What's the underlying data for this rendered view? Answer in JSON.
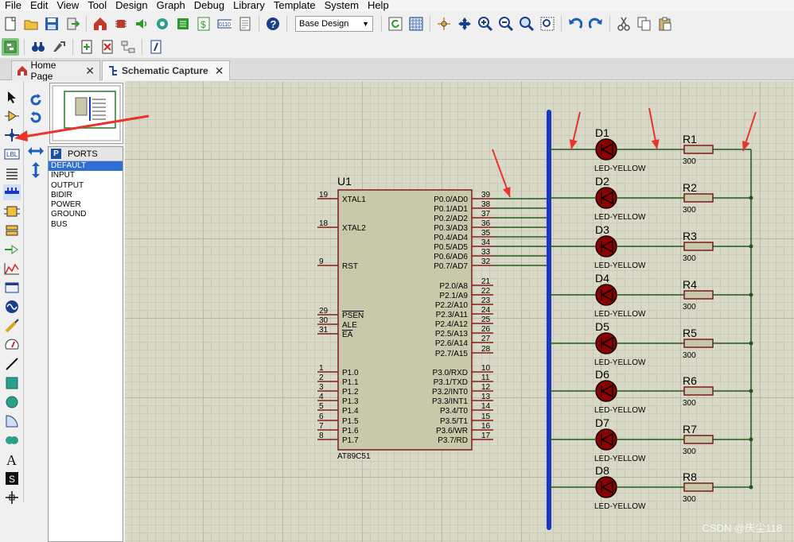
{
  "menu": [
    "File",
    "Edit",
    "View",
    "Tool",
    "Design",
    "Graph",
    "Debug",
    "Library",
    "Template",
    "System",
    "Help"
  ],
  "toolbar": {
    "design_select": "Base Design",
    "left_icons": [
      "new-file-icon",
      "open-folder-icon",
      "save-icon",
      "import-icon",
      "home-icon",
      "chip-icon",
      "audio-icon",
      "probe-icon",
      "bill-icon",
      "dollar-icon",
      "binary-icon",
      "document-icon",
      "help-icon"
    ],
    "right_icons": [
      "refresh-icon",
      "grid-icon",
      "origin-icon",
      "pan-icon",
      "zoom-in-icon",
      "zoom-out-icon",
      "zoom-all-icon",
      "zoom-area-icon",
      "undo-icon",
      "redo-icon",
      "cut-icon",
      "copy-icon",
      "paste-icon"
    ]
  },
  "tabs": [
    {
      "label": "Home Page",
      "icon": "home-icon"
    },
    {
      "label": "Schematic Capture",
      "icon": "schematic-icon"
    }
  ],
  "ports_panel": {
    "badge": "P",
    "title": "PORTS",
    "items": [
      "DEFAULT",
      "INPUT",
      "OUTPUT",
      "BIDIR",
      "POWER",
      "GROUND",
      "BUS"
    ],
    "selected": "DEFAULT"
  },
  "chip": {
    "ref": "U1",
    "part": "AT89C51",
    "left_pins": [
      {
        "num": "19",
        "name": "XTAL1"
      },
      {
        "num": "18",
        "name": "XTAL2"
      },
      {
        "num": "9",
        "name": "RST"
      },
      {
        "num": "29",
        "name": "PSEN"
      },
      {
        "num": "30",
        "name": "ALE"
      },
      {
        "num": "31",
        "name": "EA"
      },
      {
        "num": "1",
        "name": "P1.0"
      },
      {
        "num": "2",
        "name": "P1.1"
      },
      {
        "num": "3",
        "name": "P1.2"
      },
      {
        "num": "4",
        "name": "P1.3"
      },
      {
        "num": "5",
        "name": "P1.4"
      },
      {
        "num": "6",
        "name": "P1.5"
      },
      {
        "num": "7",
        "name": "P1.6"
      },
      {
        "num": "8",
        "name": "P1.7"
      }
    ],
    "right_pins": [
      {
        "num": "39",
        "name": "P0.0/AD0"
      },
      {
        "num": "38",
        "name": "P0.1/AD1"
      },
      {
        "num": "37",
        "name": "P0.2/AD2"
      },
      {
        "num": "36",
        "name": "P0.3/AD3"
      },
      {
        "num": "35",
        "name": "P0.4/AD4"
      },
      {
        "num": "34",
        "name": "P0.5/AD5"
      },
      {
        "num": "33",
        "name": "P0.6/AD6"
      },
      {
        "num": "32",
        "name": "P0.7/AD7"
      },
      {
        "num": "21",
        "name": "P2.0/A8"
      },
      {
        "num": "22",
        "name": "P2.1/A9"
      },
      {
        "num": "23",
        "name": "P2.2/A10"
      },
      {
        "num": "24",
        "name": "P2.3/A11"
      },
      {
        "num": "25",
        "name": "P2.4/A12"
      },
      {
        "num": "26",
        "name": "P2.5/A13"
      },
      {
        "num": "27",
        "name": "P2.6/A14"
      },
      {
        "num": "28",
        "name": "P2.7/A15"
      },
      {
        "num": "10",
        "name": "P3.0/RXD"
      },
      {
        "num": "11",
        "name": "P3.1/TXD"
      },
      {
        "num": "12",
        "name": "P3.2/INT0"
      },
      {
        "num": "13",
        "name": "P3.3/INT1"
      },
      {
        "num": "14",
        "name": "P3.4/T0"
      },
      {
        "num": "15",
        "name": "P3.5/T1"
      },
      {
        "num": "16",
        "name": "P3.6/WR"
      },
      {
        "num": "17",
        "name": "P3.7/RD"
      }
    ]
  },
  "leds": [
    {
      "ref": "D1",
      "type": "LED-YELLOW"
    },
    {
      "ref": "D2",
      "type": "LED-YELLOW"
    },
    {
      "ref": "D3",
      "type": "LED-YELLOW"
    },
    {
      "ref": "D4",
      "type": "LED-YELLOW"
    },
    {
      "ref": "D5",
      "type": "LED-YELLOW"
    },
    {
      "ref": "D6",
      "type": "LED-YELLOW"
    },
    {
      "ref": "D7",
      "type": "LED-YELLOW"
    },
    {
      "ref": "D8",
      "type": "LED-YELLOW"
    }
  ],
  "resistors": [
    {
      "ref": "R1",
      "value": "300"
    },
    {
      "ref": "R2",
      "value": "300"
    },
    {
      "ref": "R3",
      "value": "300"
    },
    {
      "ref": "R4",
      "value": "300"
    },
    {
      "ref": "R5",
      "value": "300"
    },
    {
      "ref": "R6",
      "value": "300"
    },
    {
      "ref": "R7",
      "value": "300"
    },
    {
      "ref": "R8",
      "value": "300"
    }
  ],
  "watermark": "CSDN @庆尘118",
  "colors": {
    "wire": "#1f5a1f",
    "bus": "#1a35c8",
    "chip_fill": "#c8c8aa",
    "pin": "#8b1a1a",
    "annotation_arrow": "#e8342a",
    "led_fill": "#8b0000"
  }
}
